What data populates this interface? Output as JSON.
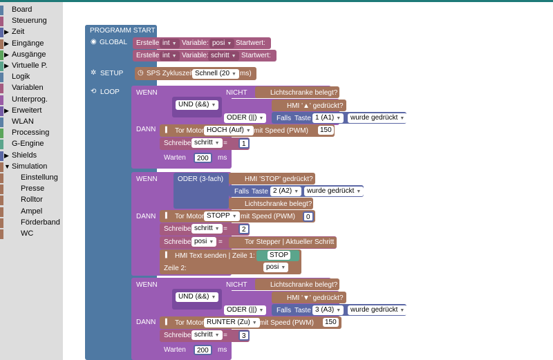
{
  "sidebar": {
    "categories": [
      {
        "label": "Board",
        "color": "#5b80a5",
        "arrow": ""
      },
      {
        "label": "Steuerung",
        "color": "#a55b80",
        "arrow": ""
      },
      {
        "label": "Zeit",
        "color": "#5b67a5",
        "arrow": "▶"
      },
      {
        "label": "Eingänge",
        "color": "#a5745b",
        "arrow": "▶"
      },
      {
        "label": "Ausgänge",
        "color": "#5ba55b",
        "arrow": "▶"
      },
      {
        "label": "Virtuelle P.",
        "color": "#5ba58c",
        "arrow": "▶"
      },
      {
        "label": "Logik",
        "color": "#5b80a5",
        "arrow": ""
      },
      {
        "label": "Variablen",
        "color": "#a55b80",
        "arrow": ""
      },
      {
        "label": "Unterprog.",
        "color": "#995ba5",
        "arrow": ""
      },
      {
        "label": "Erweitert",
        "color": "#745ba5",
        "arrow": "▶"
      },
      {
        "label": "WLAN",
        "color": "#5b80a5",
        "arrow": ""
      },
      {
        "label": "Processing",
        "color": "#5ba55b",
        "arrow": ""
      },
      {
        "label": "G-Engine",
        "color": "#5ba58c",
        "arrow": ""
      },
      {
        "label": "Shields",
        "color": "#5b67a5",
        "arrow": "▶"
      },
      {
        "label": "Simulation",
        "color": "#a5745b",
        "arrow": "▼"
      }
    ],
    "subcategories": [
      {
        "label": "Einstellung",
        "color": "#a5745b"
      },
      {
        "label": "Presse",
        "color": "#a5745b"
      },
      {
        "label": "Rolltor",
        "color": "#a5745b"
      },
      {
        "label": "Ampel",
        "color": "#a5745b"
      },
      {
        "label": "Förderband",
        "color": "#a5745b"
      },
      {
        "label": "WC",
        "color": "#a5745b"
      }
    ]
  },
  "colors": {
    "program": "#4f79a3",
    "variable": "#a55b80",
    "logic": "#9a5cb4",
    "logic_dark": "#7a4a9e",
    "io": "#a5745b",
    "time": "#5b67a5",
    "blue": "#5b67a5",
    "green": "#5ba55b",
    "topbar": "#1e7a78"
  },
  "program": {
    "title": "PROGRAMM START",
    "global_label": "GLOBAL",
    "setup_label": "SETUP",
    "loop_label": "LOOP",
    "global_rows": [
      {
        "create": "Erstelle",
        "type": "int",
        "var_label": "Variable:",
        "var": "posi",
        "start": "Startwert:"
      },
      {
        "create": "Erstelle",
        "type": "int",
        "var_label": "Variable:",
        "var": "schritt",
        "start": "Startwert:"
      }
    ],
    "setup": {
      "label": "SPS Zykluszeit",
      "value": "Schnell (20",
      "unit": "ms)"
    },
    "wenn": "WENN",
    "dann": "DANN",
    "block1": {
      "nicht": "NICHT",
      "lichtschranke": "Lichtschranke belegt?",
      "und": "UND (&&)",
      "hmi_up": "HMI '▲' gedrückt?",
      "oder": "ODER (||)",
      "falls": "Falls",
      "taste": "Taste",
      "taste_val": "1 (A1)",
      "gedrueckt": "wurde gedrückt",
      "motor": "Tor Motor",
      "motor_val": "HOCH (Auf)",
      "speed": "mit Speed (PWM)",
      "speed_val": "150",
      "schreibe": "Schreibe",
      "var": "schritt",
      "eq": "=",
      "num": "1",
      "warten": "Warten",
      "ms_val": "200",
      "ms": "ms"
    },
    "block2": {
      "oder": "ODER (3-fach)",
      "hmi_stop": "HMI 'STOP' gedrückt?",
      "falls": "Falls",
      "taste": "Taste",
      "taste_val": "2 (A2)",
      "gedrueckt": "wurde gedrückt",
      "lichtschranke": "Lichtschranke belegt?",
      "motor": "Tor Motor",
      "motor_val": "STOPP",
      "speed": "mit Speed (PWM)",
      "speed_val": "0",
      "schreibe": "Schreibe",
      "var": "schritt",
      "eq": "=",
      "num": "2",
      "var2": "posi",
      "stepper": "Tor Stepper | Aktueller Schritt",
      "hmi_text": "HMI Text senden | Zeile 1:",
      "stop_text": "STOP",
      "zeile2": "Zeile 2:",
      "zeile2_var": "posi"
    },
    "block3": {
      "nicht": "NICHT",
      "lichtschranke": "Lichtschranke belegt?",
      "und": "UND (&&)",
      "hmi_down": "HMI '▼' gedrückt?",
      "oder": "ODER (||)",
      "falls": "Falls",
      "taste": "Taste",
      "taste_val": "3 (A3)",
      "gedrueckt": "wurde gedrückt",
      "motor": "Tor Motor",
      "motor_val": "RUNTER (Zu)",
      "speed": "mit Speed (PWM)",
      "speed_val": "150",
      "schreibe": "Schreibe",
      "var": "schritt",
      "eq": "=",
      "num": "3",
      "warten": "Warten",
      "ms_val": "200",
      "ms": "ms"
    }
  }
}
